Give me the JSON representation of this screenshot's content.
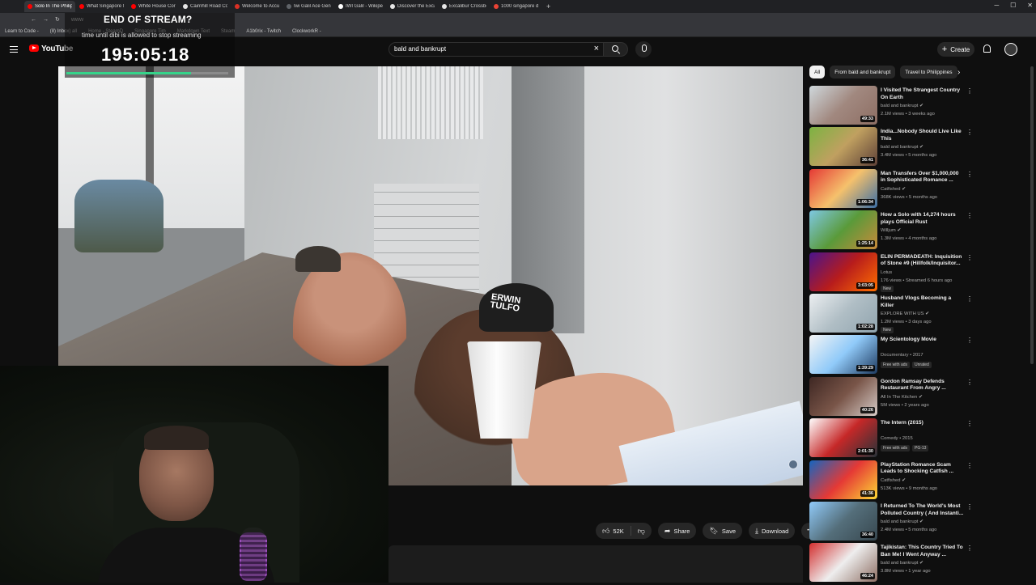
{
  "browser": {
    "tabs": [
      {
        "title": "Solo In The Philippine's Mo",
        "color": "#ff0000",
        "active": true
      },
      {
        "title": "What Singapore Nightlife L",
        "color": "#ff0000"
      },
      {
        "title": "White House Correspondei",
        "color": "#ff0000"
      },
      {
        "title": "Cairnhill Road Conservatio",
        "color": "#e5e5e5"
      },
      {
        "title": "Welcome to Accuracy Inter",
        "color": "#d93025"
      },
      {
        "title": "Iwi Galil Ace Gen 2 - For Sa",
        "color": "#5f6368"
      },
      {
        "title": "IWI Galil - Wikipedia",
        "color": "#ffffff"
      },
      {
        "title": "Discover the Excalibur Mag",
        "color": "#e5e5e5"
      },
      {
        "title": "Excalibur Crossbows From",
        "color": "#e5e5e5"
      },
      {
        "title": "1000 singapore dollars to p",
        "color": "#ea4335"
      }
    ],
    "new_tab": "+",
    "address": "www",
    "bookmarks": [
      "Learn to Code -",
      "(8) Inbox) all",
      "Home - SteamD",
      "Singapore Tim",
      "Markdown Text",
      "Steam",
      "A1b0rix - Twitch",
      "ClockworkR -"
    ]
  },
  "overlay": {
    "title": "END OF STREAM?",
    "subtitle": "time until dibi is allowed to stop streaming",
    "timer": "195:05:18",
    "progress": 0.77
  },
  "header": {
    "logo_text": "YouTube",
    "search_value": "bald and bankrupt",
    "create_label": "Create"
  },
  "video": {
    "cap_text": "ERWIN TULFO"
  },
  "actions": {
    "likes": "52K",
    "share": "Share",
    "save": "Save",
    "download": "Download",
    "more": "•••"
  },
  "sidebar": {
    "chips": [
      {
        "label": "All",
        "active": true
      },
      {
        "label": "From bald and bankrupt"
      },
      {
        "label": "Travel to Philippines"
      }
    ],
    "recommendations": [
      {
        "title": "I Visited The Strangest Country On Earth",
        "channel": "bald and bankrupt",
        "verified": true,
        "meta": "2.1M views • 3 weeks ago",
        "duration": "49:33",
        "thumb": "linear-gradient(135deg,#cfd8dc,#a1887f 50%,#8d6e63)"
      },
      {
        "title": "India...Nobody Should Live Like This",
        "channel": "bald and bankrupt",
        "verified": true,
        "meta": "3.4M views • 5 months ago",
        "duration": "36:41",
        "thumb": "linear-gradient(135deg,#7cb342,#c0a060 50%,#5d4037)"
      },
      {
        "title": "Man Transfers Over $1,000,000 in Sophisticated Romance ...",
        "channel": "Catfished",
        "verified": true,
        "meta": "368K views • 5 months ago",
        "duration": "1:06:34",
        "thumb": "linear-gradient(135deg,#e53935,#f5c16c 50%,#3b6ea5)"
      },
      {
        "title": "How a Solo with 14,274 hours plays Official Rust",
        "channel": "Willjum",
        "verified": true,
        "meta": "1.3M views • 4 months ago",
        "duration": "1:25:14",
        "thumb": "linear-gradient(135deg,#7ec8e3,#5a9a3a 50%,#c98a3a)"
      },
      {
        "title": "ELIN PERMADEATH: Inquisition of Stone #9 (Hillfolk/Inquisitor...",
        "channel": "Lotus",
        "verified": false,
        "meta": "176 views • Streamed 6 hours ago",
        "badges": [
          "New"
        ],
        "duration": "3:03:05",
        "thumb": "linear-gradient(135deg,#4a148c,#b71c1c 50%,#ff6f00)"
      },
      {
        "title": "Husband Vlogs Becoming a Killer",
        "channel": "EXPLORE WITH US",
        "verified": true,
        "meta": "1.2M views • 3 days ago",
        "badges": [
          "New"
        ],
        "duration": "1:02:28",
        "thumb": "linear-gradient(135deg,#eceff1,#b0bec5 50%,#90a4ae)"
      },
      {
        "title": "My Scientology Movie",
        "channel": "Documentary • 2017",
        "verified": false,
        "meta": "",
        "badges": [
          "Free with ads",
          "Unrated"
        ],
        "duration": "1:39:29",
        "thumb": "linear-gradient(135deg,#f5f5f5,#90caf9 50%,#1e3a5f)"
      },
      {
        "title": "Gordon Ramsay Defends Restaurant From Angry ...",
        "channel": "All In The Kitchen",
        "verified": true,
        "meta": "5M views • 2 years ago",
        "duration": "40:26",
        "thumb": "linear-gradient(135deg,#3e2723,#795548 50%,#d7ccc8)"
      },
      {
        "title": "The Intern (2015)",
        "channel": "Comedy • 2015",
        "verified": false,
        "meta": "",
        "badges": [
          "Free with ads",
          "PG-13"
        ],
        "duration": "2:01:30",
        "thumb": "linear-gradient(135deg,#ffffff,#c62828 50%,#263238)"
      },
      {
        "title": "PlayStation Romance Scam Leads to Shocking Catfish ...",
        "channel": "Catfished",
        "verified": true,
        "meta": "513K views • 9 months ago",
        "duration": "41:36",
        "thumb": "linear-gradient(135deg,#1565c0,#e53935 50%,#fdd835)"
      },
      {
        "title": "I Returned To The World's Most Polluted Country ( And Instanti...",
        "channel": "bald and bankrupt",
        "verified": true,
        "meta": "2.4M views • 5 months ago",
        "duration": "36:40",
        "thumb": "linear-gradient(135deg,#90caf9,#546e7a 50%,#37474f)"
      },
      {
        "title": "Tajikistan: This Country Tried To Ban Me! I Went Anyway ...",
        "channel": "bald and bankrupt",
        "verified": true,
        "meta": "3.8M views • 1 year ago",
        "duration": "46:24",
        "thumb": "linear-gradient(135deg,#d32f2f,#eeeeee 50%,#8d6e63)"
      }
    ]
  }
}
